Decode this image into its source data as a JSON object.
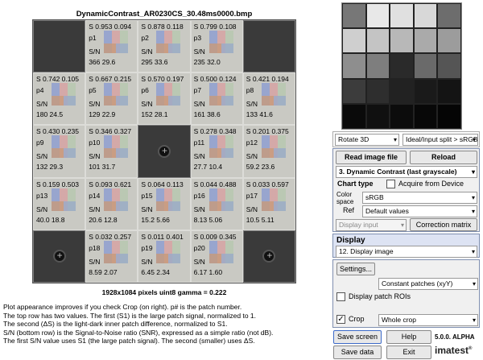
{
  "chart": {
    "title": "DynamicContrast_AR0230CS_30.48ms0000.bmp",
    "image_info": "1928x1084 pixels    uint8    gamma = 0.222",
    "rows": [
      [
        {
          "kind": "dark"
        },
        {
          "kind": "patch",
          "s": "S 0.953 0.094",
          "pid": "p1",
          "sn": "S/N",
          "snv": "366  29.6"
        },
        {
          "kind": "patch",
          "s": "S 0.878 0.118",
          "pid": "p2",
          "sn": "S/N",
          "snv": "295  33.6"
        },
        {
          "kind": "patch",
          "s": "S 0.799 0.108",
          "pid": "p3",
          "sn": "S/N",
          "snv": "235  32.0"
        },
        {
          "kind": "dark"
        }
      ],
      [
        {
          "kind": "patch",
          "s": "S 0.742 0.105",
          "pid": "p4",
          "sn": "S/N",
          "snv": "180  24.5"
        },
        {
          "kind": "patch",
          "s": "S 0.667 0.215",
          "pid": "p5",
          "sn": "S/N",
          "snv": "129  22.9"
        },
        {
          "kind": "patch",
          "s": "S 0.570 0.197",
          "pid": "p6",
          "sn": "S/N",
          "snv": "152  28.1"
        },
        {
          "kind": "patch",
          "s": "S 0.500 0.124",
          "pid": "p7",
          "sn": "S/N",
          "snv": "161  38.6"
        },
        {
          "kind": "patch",
          "s": "S 0.421 0.194",
          "pid": "p8",
          "sn": "S/N",
          "snv": "133  41.6"
        }
      ],
      [
        {
          "kind": "patch",
          "s": "S 0.430 0.235",
          "pid": "p9",
          "sn": "S/N",
          "snv": "132  29.3"
        },
        {
          "kind": "patch",
          "s": "S 0.346 0.327",
          "pid": "p10",
          "sn": "S/N",
          "snv": "101  31.7"
        },
        {
          "kind": "target"
        },
        {
          "kind": "patch",
          "s": "S 0.278 0.348",
          "pid": "p11",
          "sn": "S/N",
          "snv": "27.7  10.4"
        },
        {
          "kind": "patch",
          "s": "S 0.201 0.375",
          "pid": "p12",
          "sn": "S/N",
          "snv": "59.2  23.6"
        }
      ],
      [
        {
          "kind": "patch",
          "s": "S 0.159 0.503",
          "pid": "p13",
          "sn": "S/N",
          "snv": "40.0  18.8"
        },
        {
          "kind": "patch",
          "s": "S 0.093 0.621",
          "pid": "p14",
          "sn": "S/N",
          "snv": "20.6  12.8"
        },
        {
          "kind": "patch",
          "s": "S 0.064 0.113",
          "pid": "p15",
          "sn": "S/N",
          "snv": "15.2  5.66"
        },
        {
          "kind": "patch",
          "s": "S 0.044 0.488",
          "pid": "p16",
          "sn": "S/N",
          "snv": "8.13  5.06"
        },
        {
          "kind": "patch",
          "s": "S 0.033 0.597",
          "pid": "p17",
          "sn": "S/N",
          "snv": "10.5  5.11"
        }
      ],
      [
        {
          "kind": "target"
        },
        {
          "kind": "patch",
          "s": "S 0.032 0.257",
          "pid": "p18",
          "sn": "S/N",
          "snv": "8.59  2.07"
        },
        {
          "kind": "patch",
          "s": "S 0.011 0.401",
          "pid": "p19",
          "sn": "S/N",
          "snv": "6.45  2.34"
        },
        {
          "kind": "patch",
          "s": "S 0.009 0.345",
          "pid": "p20",
          "sn": "S/N",
          "snv": "6.17  1.60"
        },
        {
          "kind": "target"
        }
      ]
    ],
    "notes": [
      "Plot appearance improves if you check Crop (on right). p# is the patch number.",
      "The top row has two values. The first (S1) is the large patch signal, normalized to 1.",
      "The second (ΔS) is the light-dark inner patch difference, normalized to S1.",
      "S/N (bottom row) is the Signal-to-Noise ratio (SNR), expressed as a simple ratio (not dB).",
      "The first S/N value uses S1 (the large patch signal). The second (smaller) uses ΔS."
    ]
  },
  "controls": {
    "rotate": "Rotate 3D",
    "split": "Ideal/Input split > sRGB",
    "read_image_file": "Read image file",
    "reload": "Reload",
    "test_select": "3.  Dynamic Contrast  (last grayscale)",
    "chart_type": "Chart type",
    "acquire": "Acquire from Device",
    "color_space_label": "Color space",
    "color_space_value": "sRGB",
    "ref_label": "Ref",
    "ref_value": "Default values",
    "display_input": "Display input",
    "correction_matrix": "Correction matrix",
    "display_header": "Display",
    "display_select": "12. Display image",
    "settings": "Settings...",
    "constant_patches": "Constant patches (xyY)",
    "display_rois": "Display patch ROIs",
    "crop": "Crop",
    "crop_select": "Whole crop",
    "save_screen": "Save screen",
    "help": "Help",
    "version": "5.0.0. ALPHA",
    "save_data": "Save data",
    "exit": "Exit",
    "brand": "imatest"
  },
  "thumbnail": {
    "rows": [
      [
        "#777777",
        "#e8e8e8",
        "#e0e0e0",
        "#d8d8d8",
        "#6d6d6d"
      ],
      [
        "#cfcfcf",
        "#c4c4c4",
        "#b8b8b8",
        "#aaaaaa",
        "#9c9c9c"
      ],
      [
        "#8e8e8e",
        "#7e7e7e",
        "#2a2a2a",
        "#6a6a6a",
        "#555555"
      ],
      [
        "#3c3c3c",
        "#2e2e2e",
        "#222222",
        "#1a1a1a",
        "#141414"
      ],
      [
        "#0a0a0a",
        "#101010",
        "#0c0c0c",
        "#080808",
        "#050505"
      ]
    ]
  }
}
